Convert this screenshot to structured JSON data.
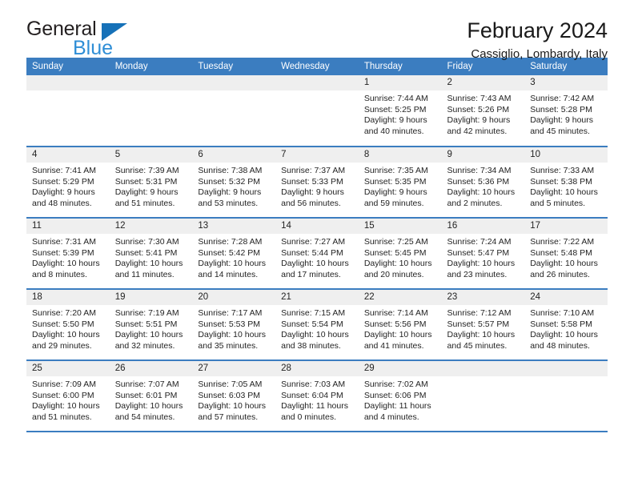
{
  "brand": {
    "name_top": "General",
    "name_bottom": "Blue",
    "accent_color": "#1671b8",
    "accent_color_light": "#2f8ed6"
  },
  "header": {
    "title": "February 2024",
    "subtitle": "Cassiglio, Lombardy, Italy"
  },
  "theme": {
    "header_bar_color": "#3b7dc0",
    "daynum_band_color": "#efefef",
    "text_color": "#232323"
  },
  "weekdays": [
    "Sunday",
    "Monday",
    "Tuesday",
    "Wednesday",
    "Thursday",
    "Friday",
    "Saturday"
  ],
  "labels": {
    "sunrise": "Sunrise:",
    "sunset": "Sunset:",
    "daylight": "Daylight:"
  },
  "weeks": [
    [
      {
        "day": "",
        "empty": true
      },
      {
        "day": "",
        "empty": true
      },
      {
        "day": "",
        "empty": true
      },
      {
        "day": "",
        "empty": true
      },
      {
        "day": "1",
        "sunrise": "Sunrise: 7:44 AM",
        "sunset": "Sunset: 5:25 PM",
        "daylight1": "Daylight: 9 hours",
        "daylight2": "and 40 minutes."
      },
      {
        "day": "2",
        "sunrise": "Sunrise: 7:43 AM",
        "sunset": "Sunset: 5:26 PM",
        "daylight1": "Daylight: 9 hours",
        "daylight2": "and 42 minutes."
      },
      {
        "day": "3",
        "sunrise": "Sunrise: 7:42 AM",
        "sunset": "Sunset: 5:28 PM",
        "daylight1": "Daylight: 9 hours",
        "daylight2": "and 45 minutes."
      }
    ],
    [
      {
        "day": "4",
        "sunrise": "Sunrise: 7:41 AM",
        "sunset": "Sunset: 5:29 PM",
        "daylight1": "Daylight: 9 hours",
        "daylight2": "and 48 minutes."
      },
      {
        "day": "5",
        "sunrise": "Sunrise: 7:39 AM",
        "sunset": "Sunset: 5:31 PM",
        "daylight1": "Daylight: 9 hours",
        "daylight2": "and 51 minutes."
      },
      {
        "day": "6",
        "sunrise": "Sunrise: 7:38 AM",
        "sunset": "Sunset: 5:32 PM",
        "daylight1": "Daylight: 9 hours",
        "daylight2": "and 53 minutes."
      },
      {
        "day": "7",
        "sunrise": "Sunrise: 7:37 AM",
        "sunset": "Sunset: 5:33 PM",
        "daylight1": "Daylight: 9 hours",
        "daylight2": "and 56 minutes."
      },
      {
        "day": "8",
        "sunrise": "Sunrise: 7:35 AM",
        "sunset": "Sunset: 5:35 PM",
        "daylight1": "Daylight: 9 hours",
        "daylight2": "and 59 minutes."
      },
      {
        "day": "9",
        "sunrise": "Sunrise: 7:34 AM",
        "sunset": "Sunset: 5:36 PM",
        "daylight1": "Daylight: 10 hours",
        "daylight2": "and 2 minutes."
      },
      {
        "day": "10",
        "sunrise": "Sunrise: 7:33 AM",
        "sunset": "Sunset: 5:38 PM",
        "daylight1": "Daylight: 10 hours",
        "daylight2": "and 5 minutes."
      }
    ],
    [
      {
        "day": "11",
        "sunrise": "Sunrise: 7:31 AM",
        "sunset": "Sunset: 5:39 PM",
        "daylight1": "Daylight: 10 hours",
        "daylight2": "and 8 minutes."
      },
      {
        "day": "12",
        "sunrise": "Sunrise: 7:30 AM",
        "sunset": "Sunset: 5:41 PM",
        "daylight1": "Daylight: 10 hours",
        "daylight2": "and 11 minutes."
      },
      {
        "day": "13",
        "sunrise": "Sunrise: 7:28 AM",
        "sunset": "Sunset: 5:42 PM",
        "daylight1": "Daylight: 10 hours",
        "daylight2": "and 14 minutes."
      },
      {
        "day": "14",
        "sunrise": "Sunrise: 7:27 AM",
        "sunset": "Sunset: 5:44 PM",
        "daylight1": "Daylight: 10 hours",
        "daylight2": "and 17 minutes."
      },
      {
        "day": "15",
        "sunrise": "Sunrise: 7:25 AM",
        "sunset": "Sunset: 5:45 PM",
        "daylight1": "Daylight: 10 hours",
        "daylight2": "and 20 minutes."
      },
      {
        "day": "16",
        "sunrise": "Sunrise: 7:24 AM",
        "sunset": "Sunset: 5:47 PM",
        "daylight1": "Daylight: 10 hours",
        "daylight2": "and 23 minutes."
      },
      {
        "day": "17",
        "sunrise": "Sunrise: 7:22 AM",
        "sunset": "Sunset: 5:48 PM",
        "daylight1": "Daylight: 10 hours",
        "daylight2": "and 26 minutes."
      }
    ],
    [
      {
        "day": "18",
        "sunrise": "Sunrise: 7:20 AM",
        "sunset": "Sunset: 5:50 PM",
        "daylight1": "Daylight: 10 hours",
        "daylight2": "and 29 minutes."
      },
      {
        "day": "19",
        "sunrise": "Sunrise: 7:19 AM",
        "sunset": "Sunset: 5:51 PM",
        "daylight1": "Daylight: 10 hours",
        "daylight2": "and 32 minutes."
      },
      {
        "day": "20",
        "sunrise": "Sunrise: 7:17 AM",
        "sunset": "Sunset: 5:53 PM",
        "daylight1": "Daylight: 10 hours",
        "daylight2": "and 35 minutes."
      },
      {
        "day": "21",
        "sunrise": "Sunrise: 7:15 AM",
        "sunset": "Sunset: 5:54 PM",
        "daylight1": "Daylight: 10 hours",
        "daylight2": "and 38 minutes."
      },
      {
        "day": "22",
        "sunrise": "Sunrise: 7:14 AM",
        "sunset": "Sunset: 5:56 PM",
        "daylight1": "Daylight: 10 hours",
        "daylight2": "and 41 minutes."
      },
      {
        "day": "23",
        "sunrise": "Sunrise: 7:12 AM",
        "sunset": "Sunset: 5:57 PM",
        "daylight1": "Daylight: 10 hours",
        "daylight2": "and 45 minutes."
      },
      {
        "day": "24",
        "sunrise": "Sunrise: 7:10 AM",
        "sunset": "Sunset: 5:58 PM",
        "daylight1": "Daylight: 10 hours",
        "daylight2": "and 48 minutes."
      }
    ],
    [
      {
        "day": "25",
        "sunrise": "Sunrise: 7:09 AM",
        "sunset": "Sunset: 6:00 PM",
        "daylight1": "Daylight: 10 hours",
        "daylight2": "and 51 minutes."
      },
      {
        "day": "26",
        "sunrise": "Sunrise: 7:07 AM",
        "sunset": "Sunset: 6:01 PM",
        "daylight1": "Daylight: 10 hours",
        "daylight2": "and 54 minutes."
      },
      {
        "day": "27",
        "sunrise": "Sunrise: 7:05 AM",
        "sunset": "Sunset: 6:03 PM",
        "daylight1": "Daylight: 10 hours",
        "daylight2": "and 57 minutes."
      },
      {
        "day": "28",
        "sunrise": "Sunrise: 7:03 AM",
        "sunset": "Sunset: 6:04 PM",
        "daylight1": "Daylight: 11 hours",
        "daylight2": "and 0 minutes."
      },
      {
        "day": "29",
        "sunrise": "Sunrise: 7:02 AM",
        "sunset": "Sunset: 6:06 PM",
        "daylight1": "Daylight: 11 hours",
        "daylight2": "and 4 minutes."
      },
      {
        "day": "",
        "empty": true
      },
      {
        "day": "",
        "empty": true
      }
    ]
  ]
}
